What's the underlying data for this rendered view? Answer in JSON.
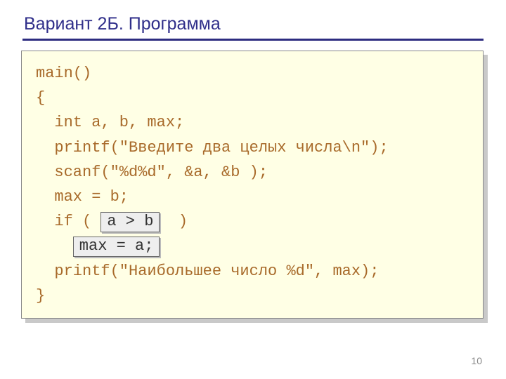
{
  "title": "Вариант 2Б. Программа",
  "code": {
    "l1": "main()",
    "l2": "{",
    "l3": "int a, b, max;",
    "l4": "printf(\"Введите два целых числа\\n\");",
    "l5": "scanf(\"%d%d\", &a, &b );",
    "l6": "max = b;",
    "l7a": "if ( ",
    "l7box": "a > b",
    "l7b": "  )",
    "l8box": "max = a;",
    "l9": "printf(\"Наибольшее число %d\", max);",
    "l10": "}"
  },
  "pageNumber": "10"
}
